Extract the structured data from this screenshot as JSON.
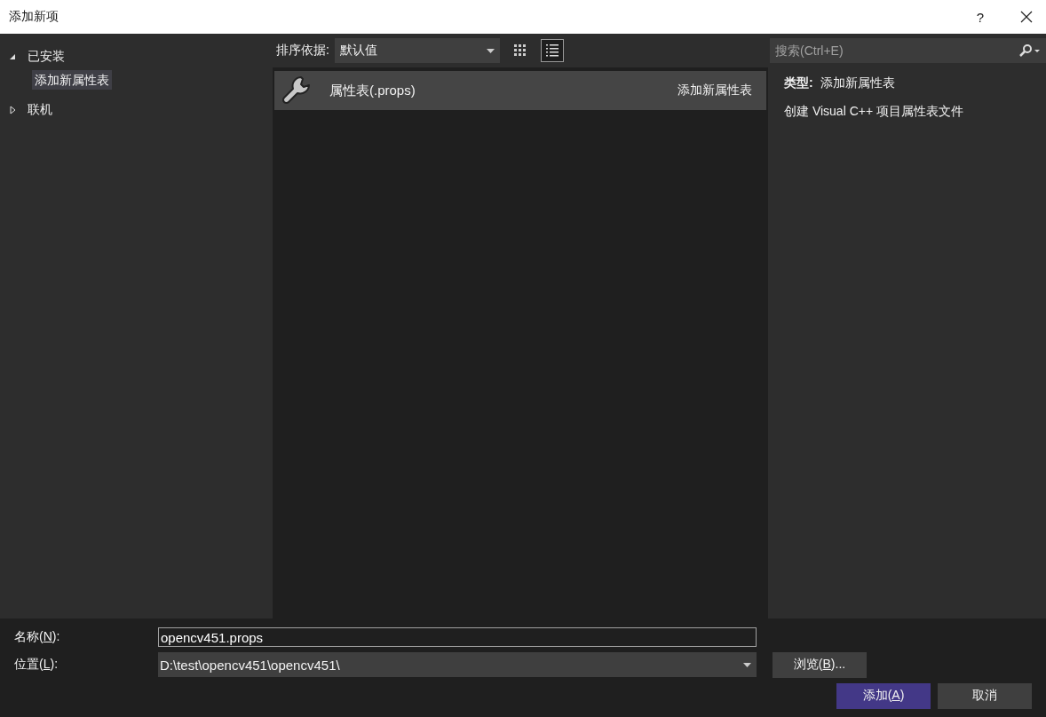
{
  "window": {
    "title": "添加新项",
    "help": "?"
  },
  "tree": [
    {
      "label": "已安装",
      "expanded": true,
      "selected": false,
      "children": [
        {
          "label": "添加新属性表",
          "selected": true
        }
      ]
    },
    {
      "label": "联机",
      "expanded": false,
      "selected": false
    }
  ],
  "sort": {
    "label": "排序依据:",
    "value": "默认值"
  },
  "view_buttons": [
    {
      "kind": "grid",
      "selected": false
    },
    {
      "kind": "list",
      "selected": true
    }
  ],
  "search": {
    "placeholder": "搜索(Ctrl+E)"
  },
  "templates": [
    {
      "name": "属性表(.props)",
      "category": "添加新属性表",
      "selected": true
    }
  ],
  "details": {
    "type_label": "类型:",
    "type_value": "添加新属性表",
    "description": "创建 Visual C++ 项目属性表文件"
  },
  "name_field": {
    "label_parts": [
      "名称(",
      "N",
      "):"
    ],
    "value": "opencv451.props"
  },
  "location_field": {
    "label_parts": [
      "位置(",
      "L",
      "):"
    ],
    "value": "D:\\test\\opencv451\\opencv451\\"
  },
  "browse_button": {
    "label_parts": [
      "浏览(",
      "B",
      ")..."
    ]
  },
  "buttons": [
    {
      "kind": "primary",
      "label_parts": [
        "添加(",
        "A",
        ")"
      ]
    },
    {
      "kind": "secondary",
      "label_parts": [
        "取消"
      ]
    }
  ]
}
